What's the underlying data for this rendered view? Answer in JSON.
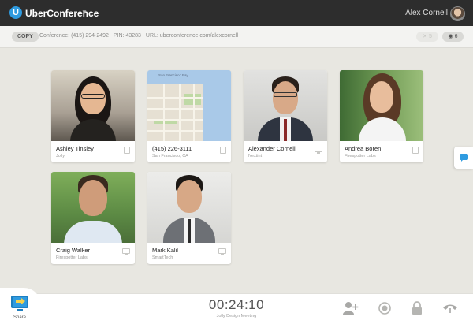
{
  "topbar": {
    "logo_letter": "U",
    "app_title": "UberConference",
    "caret": "▼",
    "user_name": "Alex Cornell"
  },
  "infobar": {
    "copy_label": "COPY",
    "conference": "Conference: (415) 294-2492",
    "pin": "PIN: 43283",
    "url": "URL: uberconference.com/alexcornell",
    "muted_count": "5",
    "views_count": "6"
  },
  "participants": [
    {
      "name": "Ashley Tinsley",
      "subtitle": "Jolly"
    },
    {
      "name": "(415) 226-3111",
      "subtitle": "San Francisco, CA"
    },
    {
      "name": "Alexander Cornell",
      "subtitle": "Nextint"
    },
    {
      "name": "Andrea Boren",
      "subtitle": "Firespotter Labs"
    },
    {
      "name": "Craig Walker",
      "subtitle": "Firespotter Labs"
    },
    {
      "name": "Mark Kalil",
      "subtitle": "SmartTech"
    }
  ],
  "map": {
    "label_bay": "San Francisco Bay"
  },
  "bottombar": {
    "share_label": "Share",
    "timer": "00:24:10",
    "meeting_name": "Jolly Design Meeting"
  },
  "colors": {
    "accent": "#2f9be0",
    "topbar": "#2d2d2d",
    "background": "#e8e7e1"
  }
}
